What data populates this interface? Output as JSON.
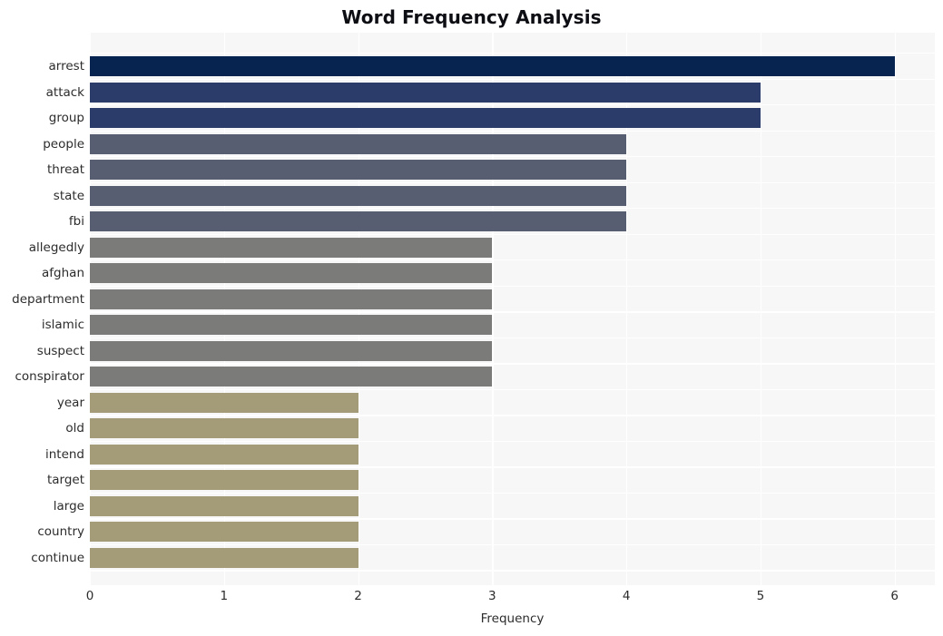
{
  "chart_data": {
    "type": "bar",
    "orientation": "horizontal",
    "title": "Word Frequency Analysis",
    "xlabel": "Frequency",
    "ylabel": "",
    "categories": [
      "arrest",
      "attack",
      "group",
      "people",
      "threat",
      "state",
      "fbi",
      "allegedly",
      "afghan",
      "department",
      "islamic",
      "suspect",
      "conspirator",
      "year",
      "old",
      "intend",
      "target",
      "large",
      "country",
      "continue"
    ],
    "values": [
      6,
      5,
      5,
      4,
      4,
      4,
      4,
      3,
      3,
      3,
      3,
      3,
      3,
      2,
      2,
      2,
      2,
      2,
      2,
      2
    ],
    "bar_colors": [
      "#06244f",
      "#2b3c6b",
      "#2b3c6b",
      "#585e72",
      "#585e72",
      "#585e72",
      "#585e72",
      "#7b7b79",
      "#7b7b79",
      "#7b7b79",
      "#7b7b79",
      "#7b7b79",
      "#7b7b79",
      "#a49c78",
      "#a49c78",
      "#a49c78",
      "#a49c78",
      "#a49c78",
      "#a49c78",
      "#a49c78"
    ],
    "xlim": [
      0,
      6.3
    ],
    "xticks": [
      0,
      1,
      2,
      3,
      4,
      5,
      6
    ],
    "xtick_labels": [
      "0",
      "1",
      "2",
      "3",
      "4",
      "5",
      "6"
    ],
    "grid": true,
    "grid_color": "#ffffff",
    "plot_background": "#f7f7f8",
    "figure_background": "#ffffff",
    "legend": null,
    "title_color": "#0d0d14",
    "tick_label_color": "#2c2c2c"
  }
}
